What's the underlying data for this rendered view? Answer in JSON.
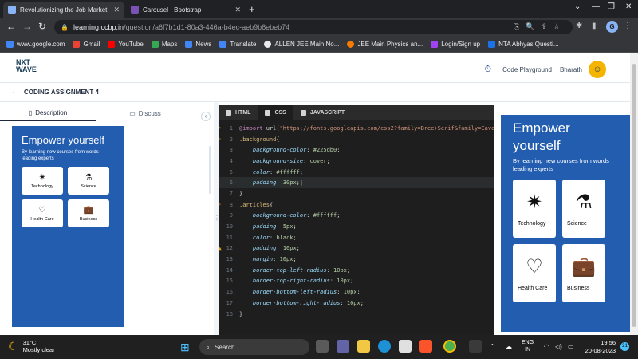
{
  "browser": {
    "tabs": [
      {
        "title": "Revolutionizing the Job Market |",
        "active": true,
        "color": "#8ab4f8"
      },
      {
        "title": "Carousel · Bootstrap",
        "active": false,
        "color": "#7952b3"
      }
    ],
    "url_host": "learning.ccbp.in",
    "url_path": "/question/a6f7b1d1-80a3-446a-b4ec-aeb9b6ebeb74",
    "profile_initial": "G",
    "bookmarks": [
      {
        "label": "www.google.com",
        "color": "#4285f4"
      },
      {
        "label": "Gmail",
        "color": "#ea4335"
      },
      {
        "label": "YouTube",
        "color": "#ff0000"
      },
      {
        "label": "Maps",
        "color": "#34a853"
      },
      {
        "label": "News",
        "color": "#4285f4"
      },
      {
        "label": "Translate",
        "color": "#4285f4"
      },
      {
        "label": "ALLEN JEE Main No...",
        "color": "#e8eaed"
      },
      {
        "label": "JEE Main Physics an...",
        "color": "#f57c00"
      },
      {
        "label": "Login/Sign up",
        "color": "#a142f4"
      },
      {
        "label": "NTA Abhyas Questi...",
        "color": "#1a73e8"
      }
    ]
  },
  "app": {
    "logo_line1": "NXT",
    "logo_line2": "WAVE",
    "code_playground": "Code Playground",
    "user_name": "Bharath",
    "assignment_title": "CODING ASSIGNMENT 4",
    "left_tabs": {
      "description": "Description",
      "discuss": "Discuss"
    },
    "preview": {
      "heading": "Empower yourself",
      "subtext": "By learning new courses from words leading experts",
      "cards": [
        "Technology",
        "Science",
        "Health Care",
        "Business"
      ]
    },
    "editor_tabs": [
      "HTML",
      "CSS",
      "JAVASCRIPT"
    ],
    "output": {
      "heading": "Empower yourself",
      "subtext": "By learning new courses from words leading experts",
      "cards": [
        "Technology",
        "Science",
        "Health Care",
        "Business"
      ]
    }
  },
  "taskbar": {
    "temperature": "31°C",
    "weather": "Mostly clear",
    "search_label": "Search",
    "lang_line1": "ENG",
    "lang_line2": "IN",
    "time": "19:56",
    "date": "20-08-2023",
    "notification_count": "21"
  }
}
